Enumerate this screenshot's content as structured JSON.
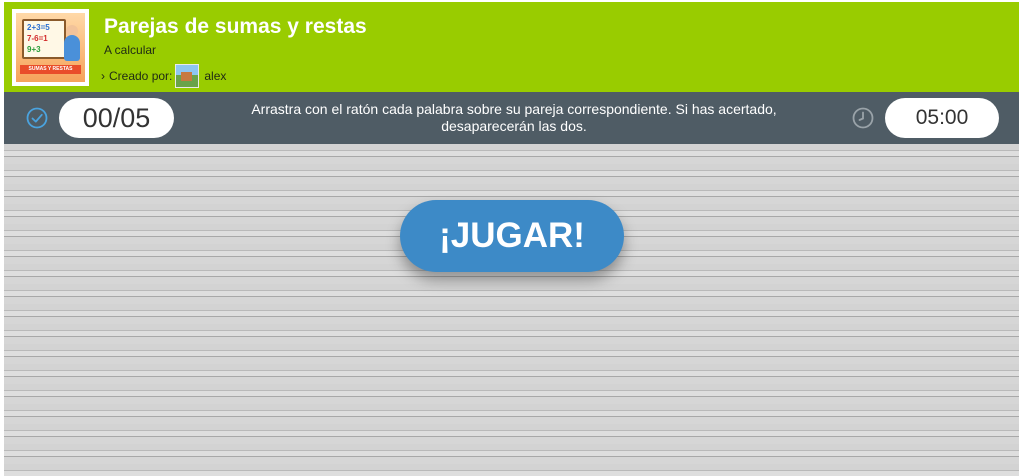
{
  "header": {
    "title": "Parejas de sumas y restas",
    "subtitle": "A calcular",
    "creator_label": "Creado por:",
    "creator_name": "alex",
    "thumbnail": {
      "band_text": "SUMAS Y RESTAS",
      "equations": [
        "2+3=5",
        "7-6=1",
        "9+3"
      ]
    }
  },
  "toolbar": {
    "score": "00/05",
    "instructions": "Arrastra con el ratón cada palabra sobre su pareja correspondiente. Si has acertado, desaparecerán las dos.",
    "timer": "05:00"
  },
  "game": {
    "play_label": "¡JUGAR!"
  },
  "colors": {
    "header_bg": "#99cc00",
    "toolbar_bg": "#4f5c65",
    "play_button": "#3d8ac7",
    "icon_blue": "#4aa3df"
  },
  "icons": {
    "score": "check-circle-icon",
    "timer": "clock-icon",
    "creator_prefix": "chevron-right-icon"
  }
}
